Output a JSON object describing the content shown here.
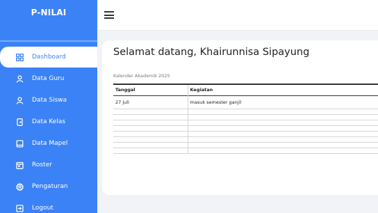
{
  "app": {
    "brand": "P-NILAI"
  },
  "sidebar": {
    "items": [
      {
        "label": "Dashboard",
        "icon": "grid-icon",
        "active": true
      },
      {
        "label": "Data Guru",
        "icon": "user-icon"
      },
      {
        "label": "Data Siswa",
        "icon": "user-icon"
      },
      {
        "label": "Data Kelas",
        "icon": "door-icon"
      },
      {
        "label": "Data Mapel",
        "icon": "book-icon"
      },
      {
        "label": "Roster",
        "icon": "calendar-icon"
      },
      {
        "label": "Pengaturan",
        "icon": "gear-icon"
      },
      {
        "label": "Logout",
        "icon": "logout-icon"
      }
    ]
  },
  "main": {
    "welcome": "Selamat datang, Khairunnisa Sipayung",
    "calendar_caption": "Kalender Akademik 2025",
    "table": {
      "headers": [
        "Tanggal",
        "Kegiatan"
      ],
      "rows": [
        [
          "27 juli",
          "masuk semester ganjil"
        ]
      ]
    }
  },
  "colors": {
    "accent": "#3b82f6",
    "background": "#f2f3f7",
    "card": "#ffffff"
  }
}
